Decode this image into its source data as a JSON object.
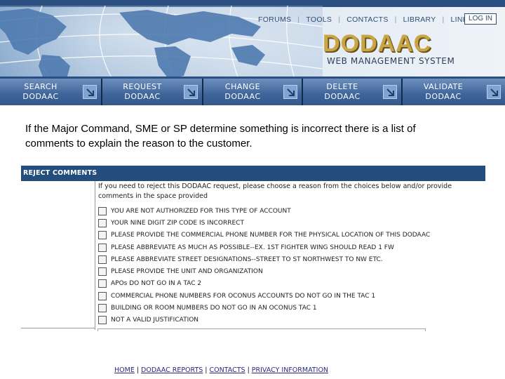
{
  "header": {
    "nav": [
      "FORUMS",
      "TOOLS",
      "CONTACTS",
      "LIBRARY",
      "LINKS"
    ],
    "login_label": "LOG IN",
    "logo": "DODAAC",
    "subtitle": "WEB MANAGEMENT SYSTEM",
    "colors": {
      "nav_text": "#2f4d74",
      "logo_gold": "#c9a545",
      "band_dark": "#2a4f80"
    }
  },
  "actions": [
    {
      "label": "SEARCH\nDODAAC",
      "icon": "arrow-down-right-icon"
    },
    {
      "label": "REQUEST\nDODAAC",
      "icon": "arrow-down-right-icon"
    },
    {
      "label": "CHANGE\nDODAAC",
      "icon": "arrow-down-right-icon"
    },
    {
      "label": "DELETE\nDODAAC",
      "icon": "arrow-down-right-icon"
    },
    {
      "label": "VALIDATE\nDODAAC",
      "icon": "arrow-down-right-icon"
    }
  ],
  "intro": "If the Major Command, SME or SP determine something is incorrect there is a list of comments to explain the reason to the customer.",
  "reject": {
    "title": "REJECT COMMENTS",
    "instructions": "If you need to reject this DODAAC request, please choose a reason from the choices below and/or provide comments in the space provided",
    "reasons": [
      "YOU ARE NOT AUTHORIZED FOR THIS TYPE OF ACCOUNT",
      "YOUR NINE DIGIT ZIP CODE IS INCORRECT",
      "PLEASE PROVIDE THE COMMERCIAL PHONE NUMBER FOR THE PHYSICAL LOCATION OF THIS DODAAC",
      "PLEASE ABBREVIATE AS MUCH AS POSSIBLE--EX. 1ST FIGHTER WING SHOULD READ 1 FW",
      "PLEASE ABBREVIATE STREET DESIGNATIONS--STREET TO ST NORTHWEST TO NW ETC.",
      "PLEASE PROVIDE THE UNIT AND ORGANIZATION",
      "APOs DO NOT GO IN A TAC 2",
      "COMMERCIAL PHONE NUMBERS FOR OCONUS ACCOUNTS DO NOT GO IN THE TAC 1",
      "BUILDING OR ROOM NUMBERS DO NOT GO IN AN OCONUS TAC 1",
      "NOT A VALID JUSTIFICATION"
    ],
    "colors": {
      "header_bg": "#234d7c"
    }
  },
  "footer": {
    "links": [
      "HOME",
      "DODAAC REPORTS",
      "CONTACTS",
      "PRIVACY INFORMATION"
    ],
    "separator": "|"
  }
}
